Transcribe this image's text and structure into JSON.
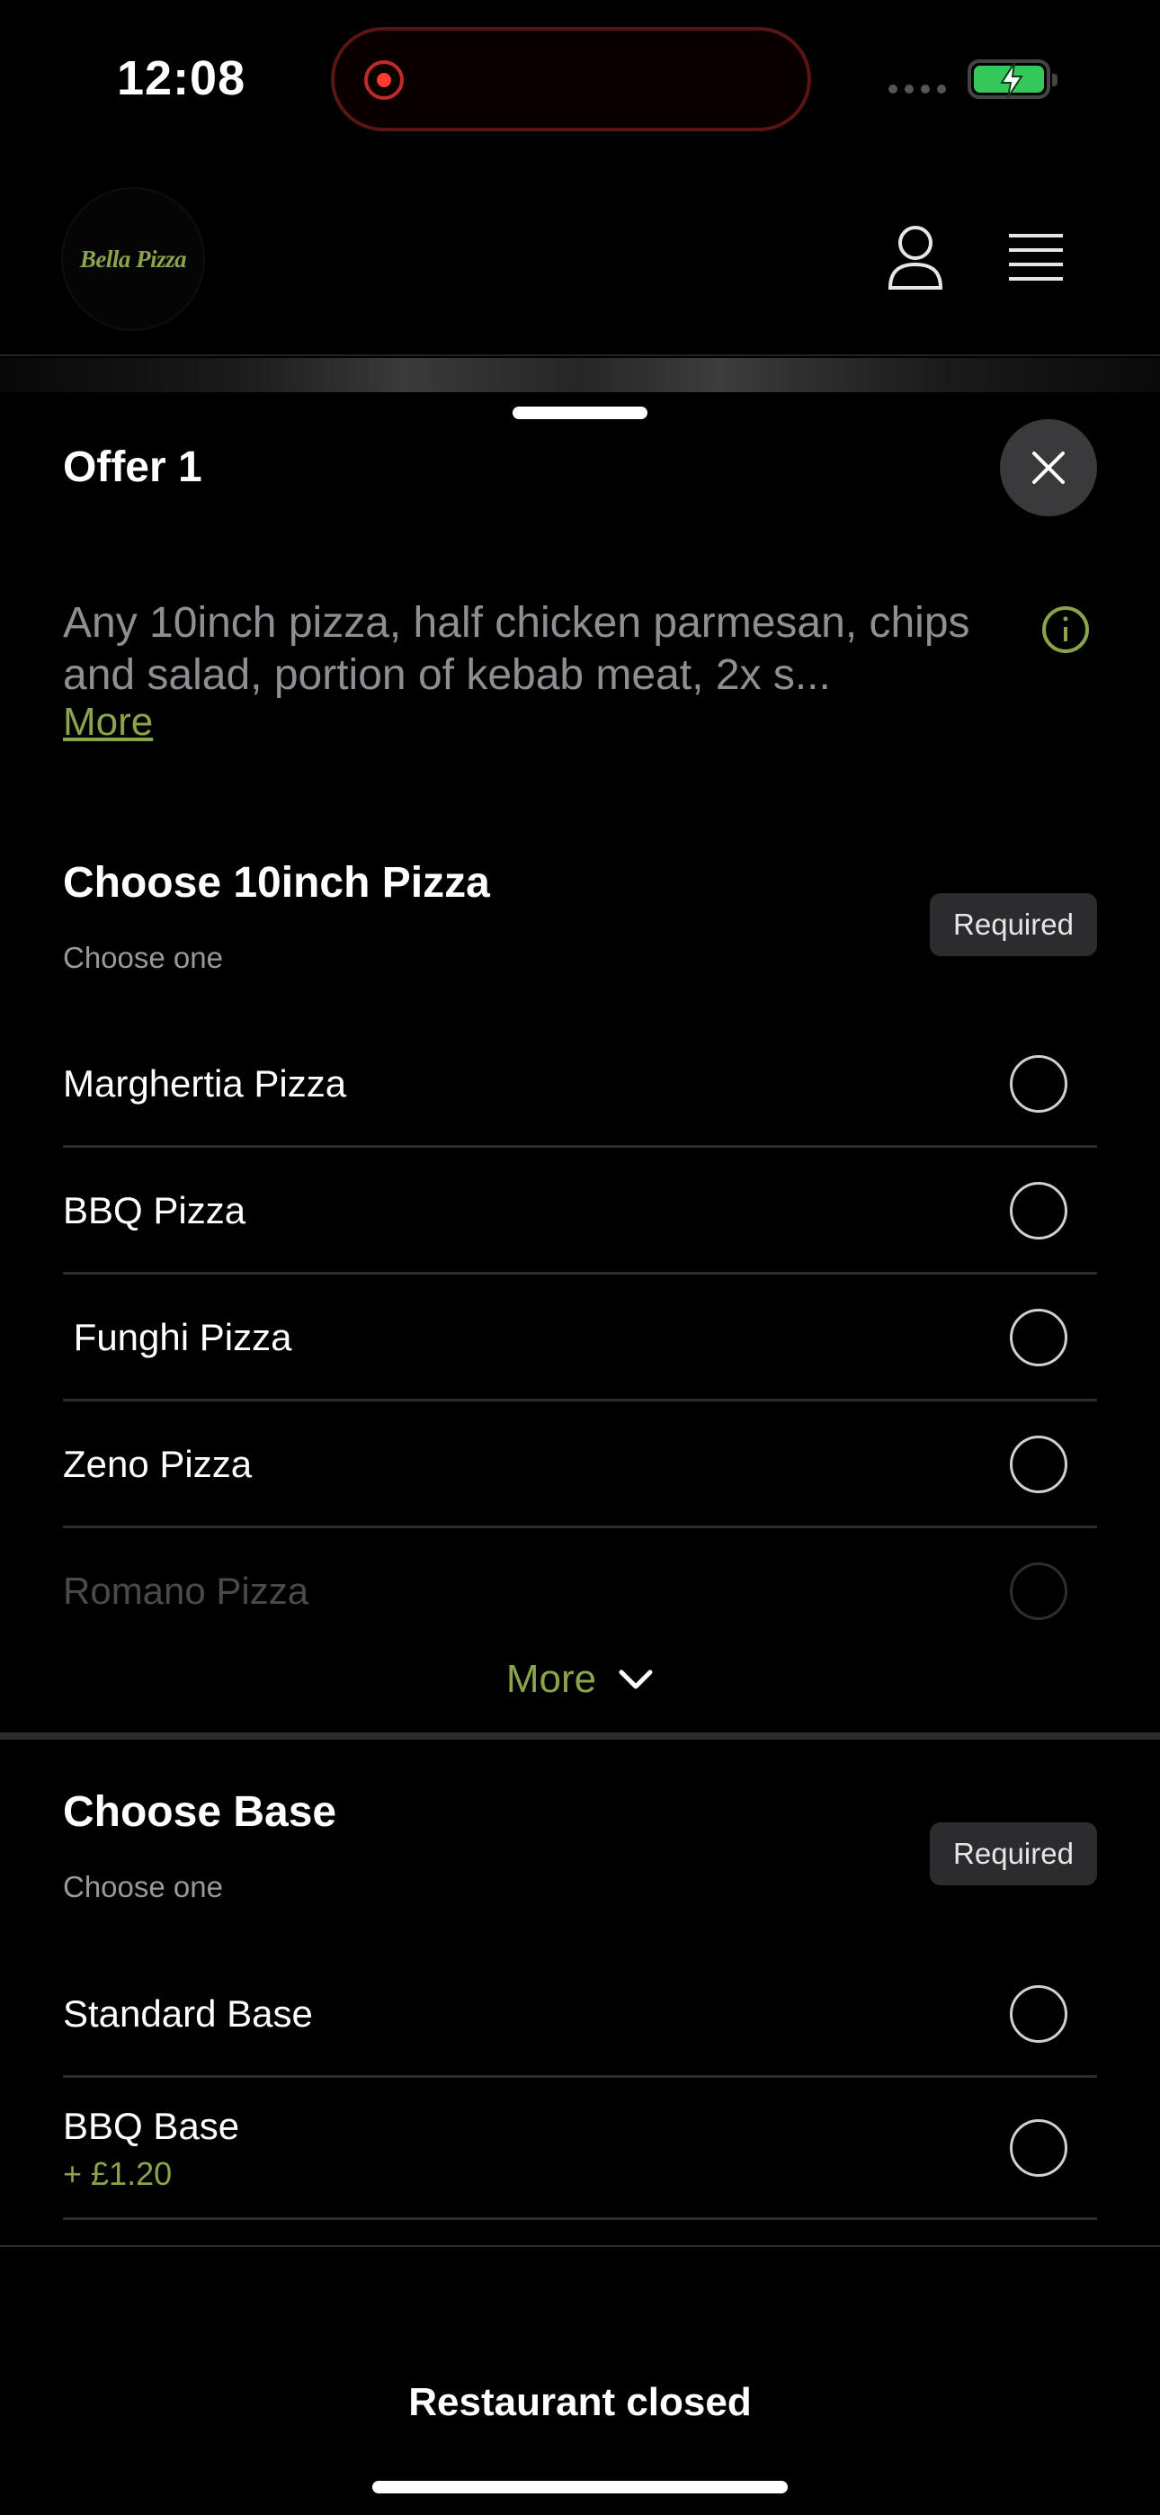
{
  "status_bar": {
    "time": "12:08"
  },
  "header": {
    "logo_text": "Bella Pizza"
  },
  "sheet": {
    "title": "Offer 1",
    "description": "Any 10inch pizza, half chicken parmesan, chips and salad, portion of kebab meat, 2x s...",
    "description_more": "More"
  },
  "section_pizza": {
    "title": "Choose 10inch Pizza",
    "subtitle": "Choose one",
    "badge": "Required",
    "options": [
      {
        "label": "Marghertia Pizza"
      },
      {
        "label": "BBQ Pizza"
      },
      {
        "label": " Funghi Pizza"
      },
      {
        "label": "Zeno Pizza"
      },
      {
        "label": "Romano Pizza"
      }
    ],
    "more_label": "More"
  },
  "section_base": {
    "title": "Choose Base",
    "subtitle": "Choose one",
    "badge": "Required",
    "options": [
      {
        "label": "Standard Base",
        "price": ""
      },
      {
        "label": "BBQ Base",
        "price": "+ £1.20"
      }
    ]
  },
  "footer": {
    "label": "Restaurant closed"
  },
  "colors": {
    "accent": "#8ba34a",
    "background": "#000000",
    "badge_bg": "#2c2c2e",
    "close_bg": "#3a3a3c"
  }
}
